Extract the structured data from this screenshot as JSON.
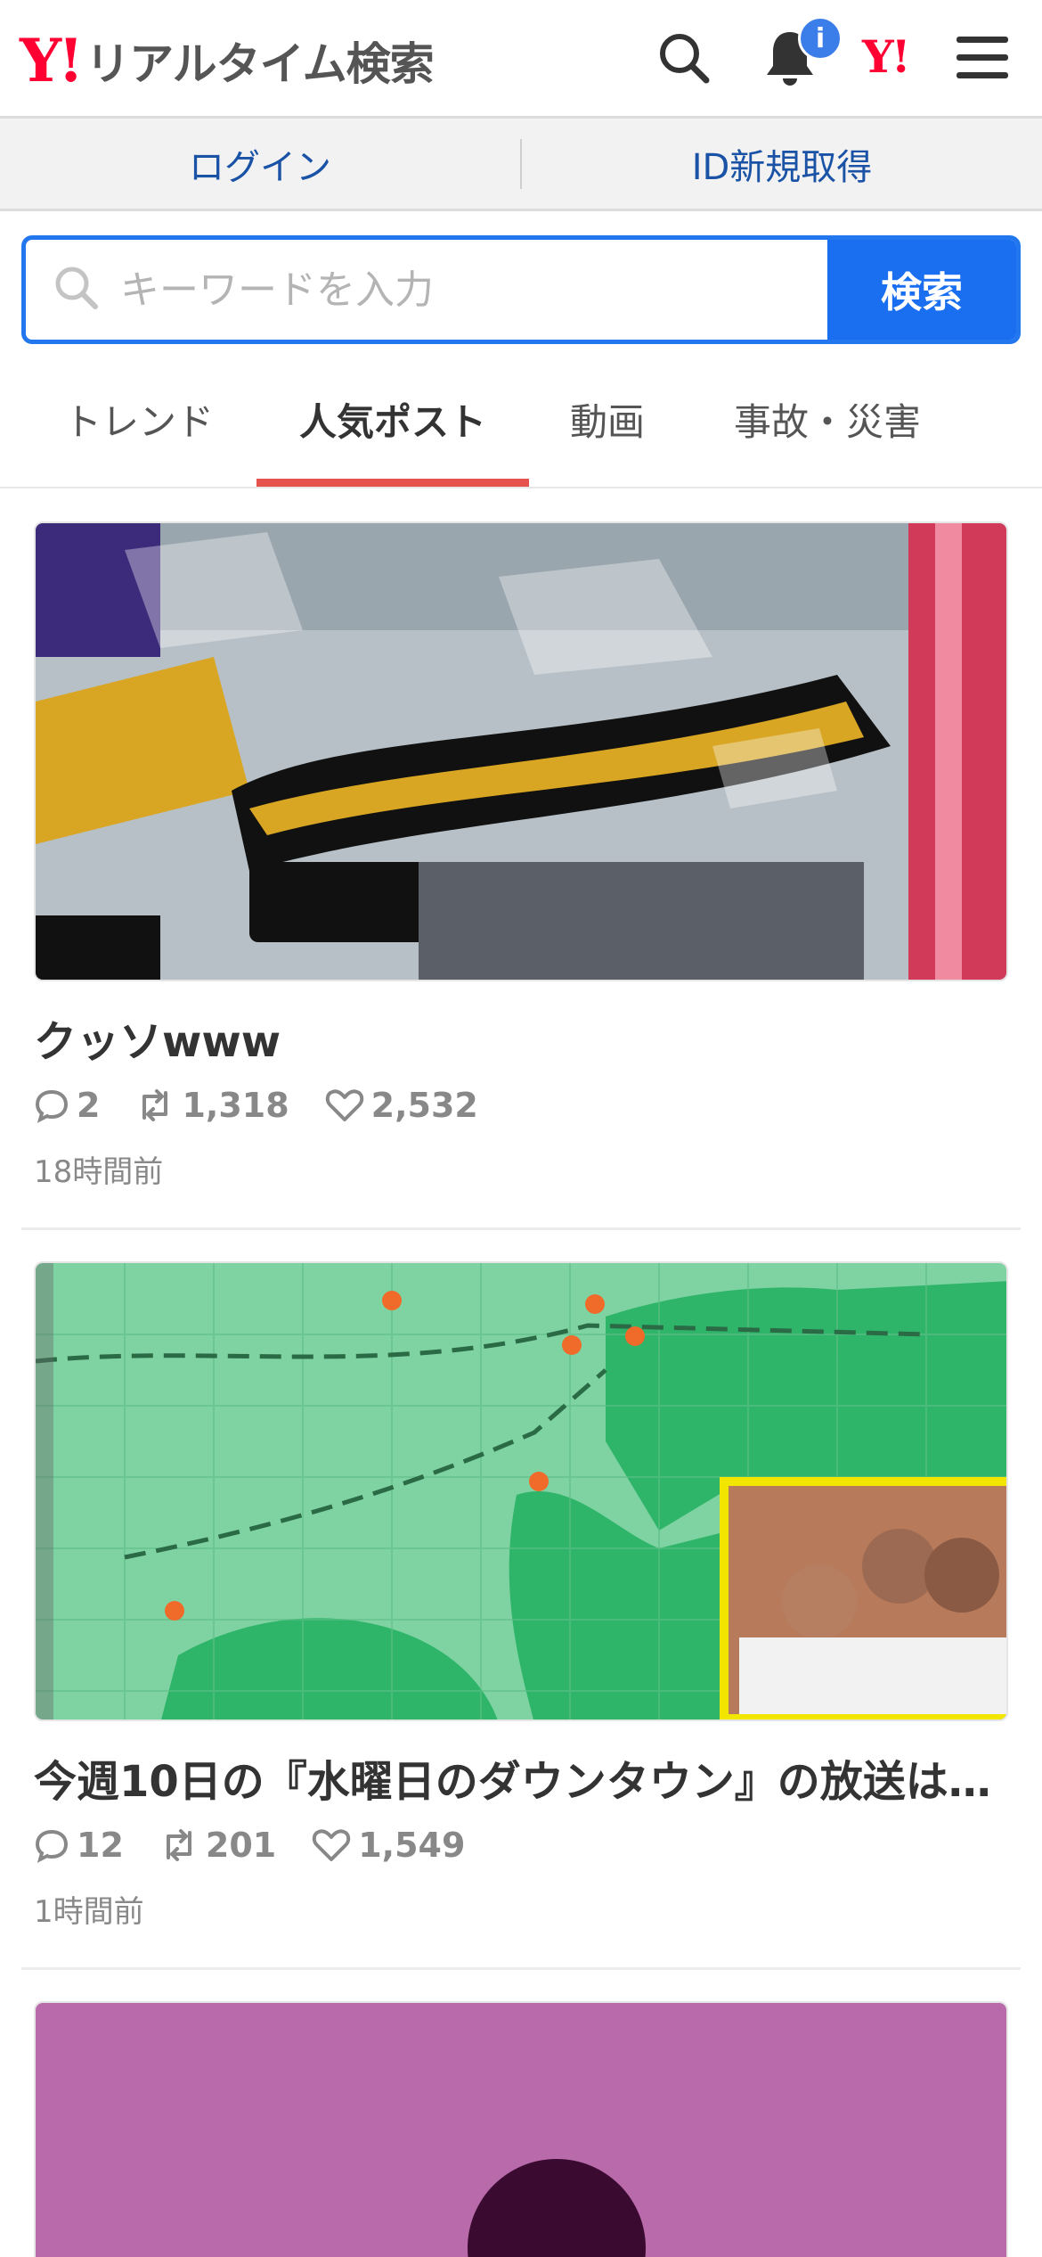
{
  "header": {
    "logo_mark": "Y!",
    "logo_text": "リアルタイム検索",
    "notification_badge": "i",
    "yahoo_mark": "Y!"
  },
  "login_bar": {
    "login": "ログイン",
    "register": "ID新規取得"
  },
  "search": {
    "placeholder": "キーワードを入力",
    "button": "検索"
  },
  "tabs": [
    {
      "label": "トレンド"
    },
    {
      "label": "人気ポスト",
      "active": true
    },
    {
      "label": "動画"
    },
    {
      "label": "事故・災害"
    }
  ],
  "posts": [
    {
      "title": "クッソwww",
      "replies": "2",
      "reposts": "1,318",
      "likes": "2,532",
      "time": "18時間前"
    },
    {
      "title": "今週10日の『水曜日のダウンタウン』の放送は…",
      "replies": "12",
      "reposts": "201",
      "likes": "1,549",
      "time": "1時間前"
    }
  ],
  "colors": {
    "brand_red": "#ff0033",
    "accent_blue": "#1a6ff1",
    "tab_underline": "#e6524e",
    "link_blue": "#1a53a6"
  }
}
